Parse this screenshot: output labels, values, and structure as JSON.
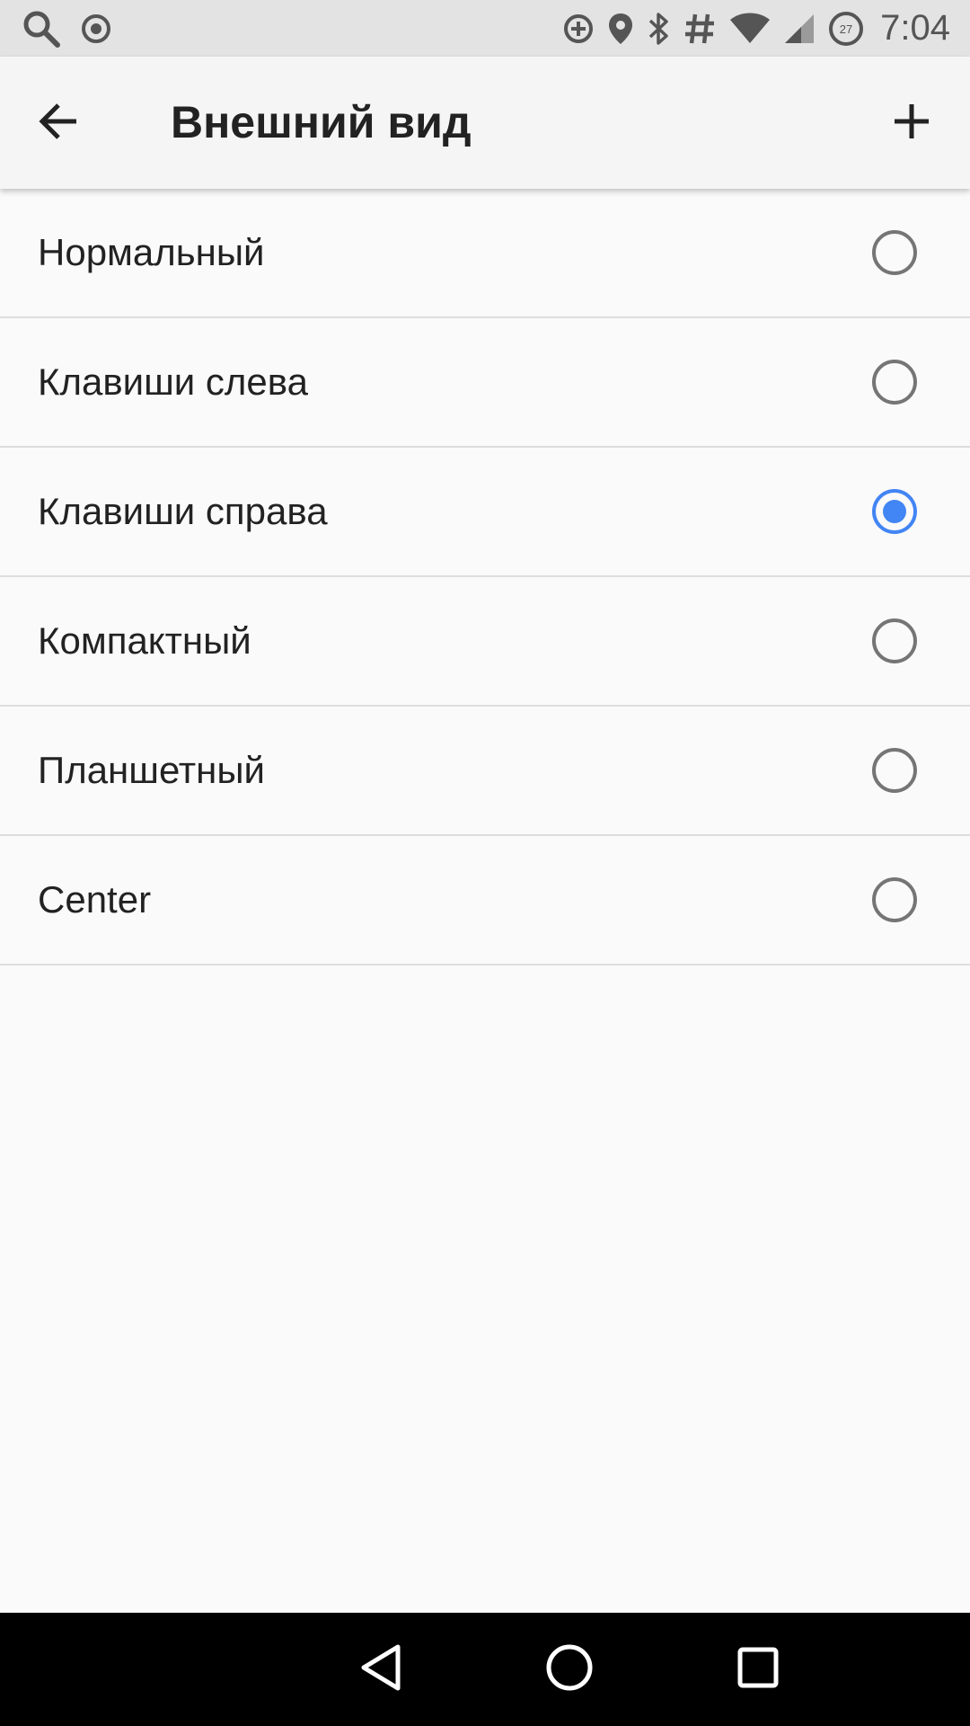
{
  "status_bar": {
    "time": "7:04",
    "left_icons": [
      "search-icon",
      "record-icon"
    ],
    "right_icons": [
      "data-saver-icon",
      "location-icon",
      "bluetooth-icon",
      "hash-icon",
      "wifi-icon",
      "signal-icon",
      "battery-icon"
    ],
    "battery_level_text": "27"
  },
  "app_bar": {
    "title": "Внешний вид",
    "back_icon": "arrow-back-icon",
    "add_icon": "plus-icon"
  },
  "options": [
    {
      "label": "Нормальный",
      "selected": false
    },
    {
      "label": "Клавиши слева",
      "selected": false
    },
    {
      "label": "Клавиши справа",
      "selected": true
    },
    {
      "label": "Компактный",
      "selected": false
    },
    {
      "label": "Планшетный",
      "selected": false
    },
    {
      "label": "Center",
      "selected": false
    }
  ],
  "colors": {
    "accent": "#4285f4",
    "radio_off": "#757575"
  },
  "nav_bar": {
    "icons": [
      "back-triangle-icon",
      "home-circle-icon",
      "recents-square-icon"
    ]
  }
}
